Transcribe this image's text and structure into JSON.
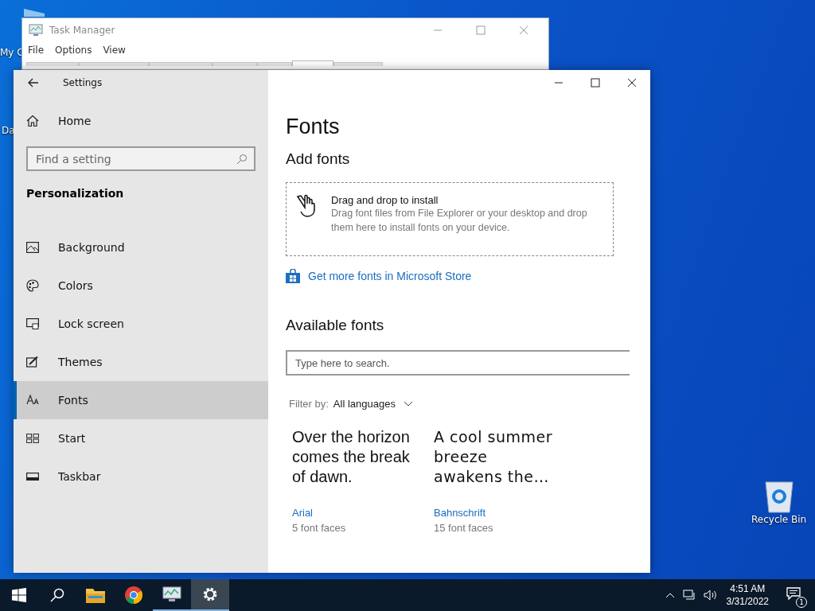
{
  "desktop": {
    "icons": [
      {
        "kind": "computer",
        "label": "My C"
      },
      {
        "kind": "folder",
        "label": "Da"
      },
      {
        "kind": "bin",
        "label": "Recycle Bin"
      }
    ]
  },
  "task_manager": {
    "title": "Task Manager",
    "menu": [
      "File",
      "Options",
      "View"
    ],
    "tabs": [
      {
        "selected": false
      },
      {
        "selected": false
      },
      {
        "selected": false
      },
      {
        "selected": false
      },
      {
        "selected": false
      },
      {
        "selected": true
      },
      {
        "selected": false
      }
    ]
  },
  "settings": {
    "title": "Settings",
    "sidebar": {
      "home": "Home",
      "search": {
        "placeholder": "Find a setting"
      },
      "section": "Personalization",
      "items": [
        {
          "label": "Background",
          "selected": false
        },
        {
          "label": "Colors",
          "selected": false
        },
        {
          "label": "Lock screen",
          "selected": false
        },
        {
          "label": "Themes",
          "selected": false
        },
        {
          "label": "Fonts",
          "selected": true
        },
        {
          "label": "Start",
          "selected": false
        },
        {
          "label": "Taskbar",
          "selected": false
        }
      ]
    },
    "content": {
      "title": "Fonts",
      "add_heading": "Add fonts",
      "drop_zone": {
        "title": "Drag and drop to install",
        "description": "Drag font files from File Explorer or your desktop and drop them here to install fonts on your device."
      },
      "store_link": "Get more fonts in Microsoft Store",
      "available_heading": "Available fonts",
      "search": {
        "placeholder": "Type here to search."
      },
      "filter": {
        "label": "Filter by:",
        "value": "All languages"
      },
      "fonts": [
        {
          "preview": "Over the horizon comes the break of dawn.",
          "name": "Arial",
          "faces": "5 font faces"
        },
        {
          "preview": "A cool summer breeze awakens the…",
          "name": "Bahnschrift",
          "faces": "15 font faces"
        }
      ]
    }
  },
  "taskbar": {
    "apps": [
      {
        "kind": "explorer",
        "running": false,
        "active": false
      },
      {
        "kind": "chrome",
        "running": false,
        "active": false
      },
      {
        "kind": "taskmgr",
        "running": true,
        "active": false
      },
      {
        "kind": "settings",
        "running": true,
        "active": true
      }
    ],
    "time": "4:51 AM",
    "date": "3/31/2022",
    "notifications": "1"
  }
}
